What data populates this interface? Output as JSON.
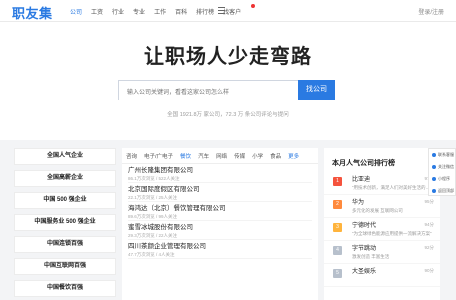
{
  "nav": {
    "logo": "职友集",
    "links": [
      "公司",
      "工资",
      "行业",
      "专业",
      "工作",
      "百科",
      "排行榜",
      "找客户"
    ],
    "auth": "登录/注册"
  },
  "hero": {
    "slogan": "让职场人少走弯路",
    "search_placeholder": "输入公司关键词，看看这家公司怎么样",
    "search_button": "找公司",
    "stats": "全国 1921.8万 家公司，72.3 万 条公司评论与提问"
  },
  "categories": [
    "全国人气企业",
    "全国高薪企业",
    "中国 500 强企业",
    "中国服务业 500 强企业",
    "中国连锁百强",
    "中国互联网百强",
    "中国餐饮百强"
  ],
  "tabs": [
    "咨询",
    "电子/广电子",
    "餐饮",
    "汽车",
    "网络",
    "传媒",
    "小学",
    "食品",
    "更多"
  ],
  "companies": [
    {
      "name": "广州长隆集团有限公司",
      "meta": "86.1万次浏览 / 522人关注"
    },
    {
      "name": "北京国际度假区有限公司",
      "meta": "22.1万次浏览 / 25人关注"
    },
    {
      "name": "海鸿达（北京）餐饮管理有限公司",
      "meta": "89.6万次浏览 / 99人关注"
    },
    {
      "name": "蜜雪冰城股份有限公司",
      "meta": "29.3万次浏览 / 22人关注"
    },
    {
      "name": "四川茶颜企业管理有限公司",
      "meta": "47.7万次浏览 / 4人关注"
    }
  ],
  "ranking": {
    "title": "本月人气公司排行榜",
    "items": [
      {
        "rank": "1",
        "name": "比亚迪",
        "sub": "“用技术创新，满足人们对美好生活的…”",
        "score": "97分",
        "color": "#f5533d"
      },
      {
        "rank": "2",
        "name": "华为",
        "sub": "多元化的发展   互联网公司",
        "score": "95分",
        "color": "#ff8a3d"
      },
      {
        "rank": "3",
        "name": "宁德时代",
        "sub": "“为全球绿色能源应用提供一流解决方案”",
        "score": "94分",
        "color": "#ffb43d"
      },
      {
        "rank": "4",
        "name": "字节跳动",
        "sub": "激发创造 丰富生活",
        "score": "92分",
        "color": "#b7c0cc"
      },
      {
        "rank": "5",
        "name": "大圣娱乐",
        "sub": "",
        "score": "90分",
        "color": "#b7c0cc"
      }
    ]
  },
  "side": [
    "联系客服",
    "关注微信",
    "小程序",
    "返回顶部"
  ]
}
